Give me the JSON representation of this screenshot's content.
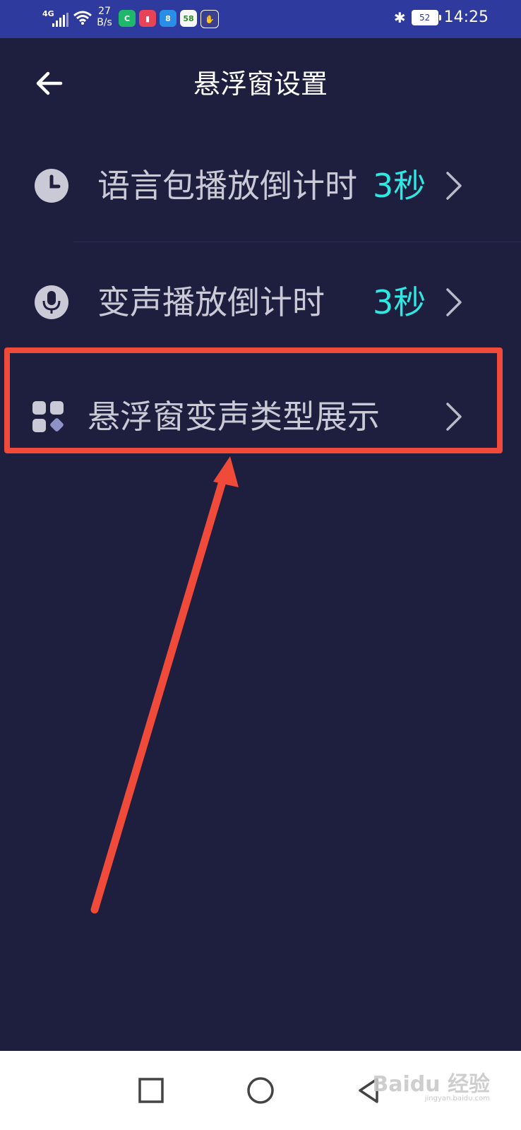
{
  "status_bar": {
    "network_type": "4G",
    "speed_value": "27",
    "speed_unit": "B/s",
    "battery": "52",
    "time": "14:25",
    "apps": [
      {
        "name": "app-green",
        "glyph": "C",
        "color": "#1fb86a"
      },
      {
        "name": "app-red-book",
        "glyph": "▮",
        "color": "#e84357"
      },
      {
        "name": "app-eight",
        "glyph": "8",
        "color": "#2a8ee6"
      },
      {
        "name": "app-58",
        "glyph": "58",
        "color": "#f7f7f7"
      },
      {
        "name": "app-shield",
        "glyph": "✋",
        "color": "#3a3f8f"
      }
    ]
  },
  "header": {
    "title": "悬浮窗设置"
  },
  "settings": [
    {
      "label": "语言包播放倒计时",
      "value": "3秒",
      "icon": "clock-icon"
    },
    {
      "label": "变声播放倒计时",
      "value": "3秒",
      "icon": "microphone-icon"
    },
    {
      "label": "悬浮窗变声类型展示",
      "value": "",
      "icon": "grid-icon"
    }
  ],
  "watermark": {
    "text": "Baidu 经验",
    "sub": "jingyan.baidu.com"
  },
  "colors": {
    "background": "#1e1e3e",
    "status_bar": "#2f3a9e",
    "accent_value": "#2ee8e2",
    "annotation": "#ef4a3a"
  }
}
